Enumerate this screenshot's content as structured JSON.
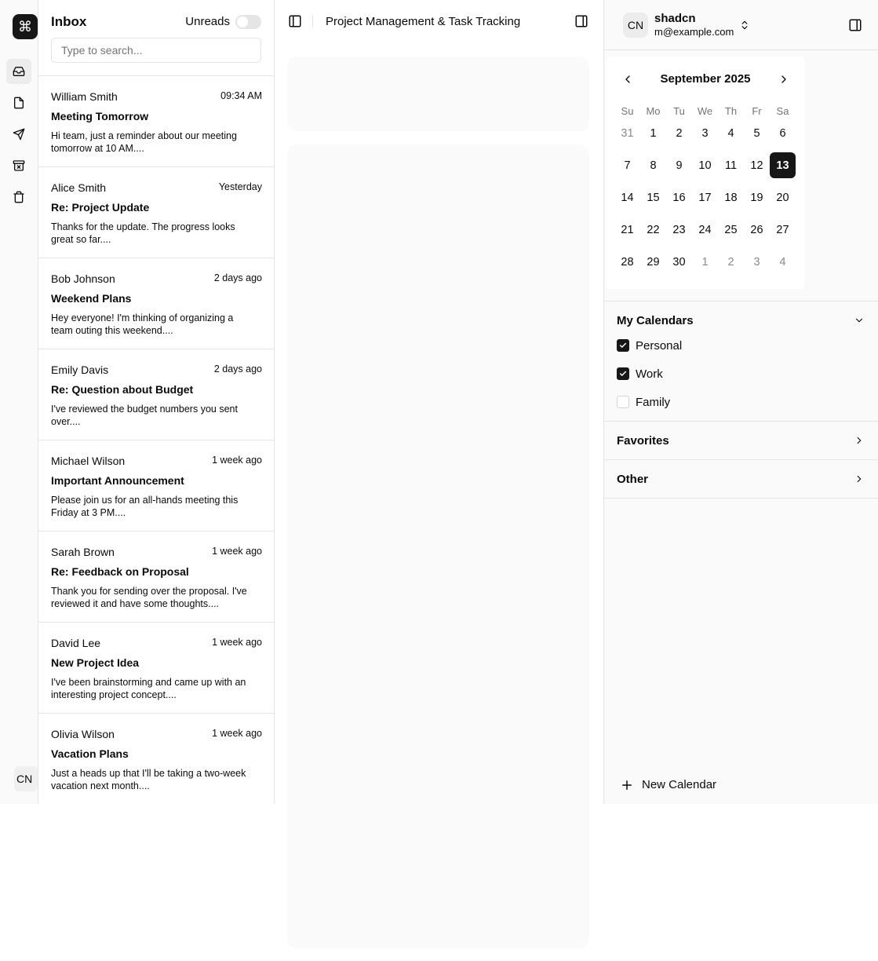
{
  "rail": {
    "logo_glyph": "⌘",
    "items": [
      {
        "name": "inbox-icon",
        "active": true
      },
      {
        "name": "file-icon",
        "active": false
      },
      {
        "name": "send-icon",
        "active": false
      },
      {
        "name": "archive-icon",
        "active": false
      },
      {
        "name": "trash-icon",
        "active": false
      }
    ],
    "avatar_initials": "CN"
  },
  "inbox": {
    "title": "Inbox",
    "unreads_label": "Unreads",
    "unreads_on": false,
    "search_placeholder": "Type to search...",
    "mails": [
      {
        "from": "William Smith",
        "time": "09:34 AM",
        "subject": "Meeting Tomorrow",
        "preview": "Hi team, just a reminder about our meeting tomorrow at 10 AM...."
      },
      {
        "from": "Alice Smith",
        "time": "Yesterday",
        "subject": "Re: Project Update",
        "preview": "Thanks for the update. The progress looks great so far...."
      },
      {
        "from": "Bob Johnson",
        "time": "2 days ago",
        "subject": "Weekend Plans",
        "preview": "Hey everyone! I'm thinking of organizing a team outing this weekend...."
      },
      {
        "from": "Emily Davis",
        "time": "2 days ago",
        "subject": "Re: Question about Budget",
        "preview": "I've reviewed the budget numbers you sent over...."
      },
      {
        "from": "Michael Wilson",
        "time": "1 week ago",
        "subject": "Important Announcement",
        "preview": "Please join us for an all-hands meeting this Friday at 3 PM...."
      },
      {
        "from": "Sarah Brown",
        "time": "1 week ago",
        "subject": "Re: Feedback on Proposal",
        "preview": "Thank you for sending over the proposal. I've reviewed it and have some thoughts...."
      },
      {
        "from": "David Lee",
        "time": "1 week ago",
        "subject": "New Project Idea",
        "preview": "I've been brainstorming and came up with an interesting project concept...."
      },
      {
        "from": "Olivia Wilson",
        "time": "1 week ago",
        "subject": "Vacation Plans",
        "preview": "Just a heads up that I'll be taking a two-week vacation next month...."
      }
    ]
  },
  "main": {
    "title": "Project Management & Task Tracking"
  },
  "sidebar": {
    "user": {
      "initials": "CN",
      "name": "shadcn",
      "email": "m@example.com"
    },
    "calendar": {
      "month_label": "September 2025",
      "weekdays": [
        "Su",
        "Mo",
        "Tu",
        "We",
        "Th",
        "Fr",
        "Sa"
      ],
      "days": [
        {
          "d": "31",
          "m": true
        },
        {
          "d": "1"
        },
        {
          "d": "2"
        },
        {
          "d": "3"
        },
        {
          "d": "4"
        },
        {
          "d": "5"
        },
        {
          "d": "6"
        },
        {
          "d": "7"
        },
        {
          "d": "8"
        },
        {
          "d": "9"
        },
        {
          "d": "10"
        },
        {
          "d": "11"
        },
        {
          "d": "12"
        },
        {
          "d": "13",
          "s": true
        },
        {
          "d": "14"
        },
        {
          "d": "15"
        },
        {
          "d": "16"
        },
        {
          "d": "17"
        },
        {
          "d": "18"
        },
        {
          "d": "19"
        },
        {
          "d": "20"
        },
        {
          "d": "21"
        },
        {
          "d": "22"
        },
        {
          "d": "23"
        },
        {
          "d": "24"
        },
        {
          "d": "25"
        },
        {
          "d": "26"
        },
        {
          "d": "27"
        },
        {
          "d": "28"
        },
        {
          "d": "29"
        },
        {
          "d": "30"
        },
        {
          "d": "1",
          "m": true
        },
        {
          "d": "2",
          "m": true
        },
        {
          "d": "3",
          "m": true
        },
        {
          "d": "4",
          "m": true
        }
      ]
    },
    "sections": {
      "my_calendars": {
        "title": "My Calendars",
        "items": [
          {
            "label": "Personal",
            "checked": true
          },
          {
            "label": "Work",
            "checked": true
          },
          {
            "label": "Family",
            "checked": false
          }
        ]
      },
      "favorites": {
        "title": "Favorites"
      },
      "other": {
        "title": "Other"
      }
    },
    "new_calendar_label": "New Calendar"
  },
  "colors": {
    "accent": "#171717",
    "border": "#e5e5e5",
    "panel": "#fafafa"
  }
}
